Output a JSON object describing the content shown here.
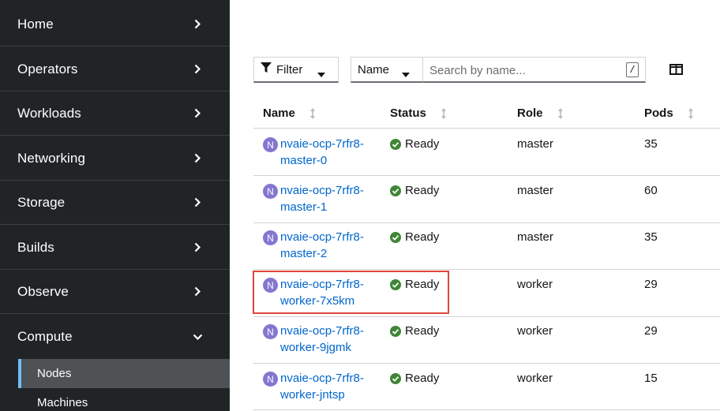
{
  "sidebar": {
    "items": [
      {
        "label": "Home",
        "expanded": false
      },
      {
        "label": "Operators",
        "expanded": false
      },
      {
        "label": "Workloads",
        "expanded": false
      },
      {
        "label": "Networking",
        "expanded": false
      },
      {
        "label": "Storage",
        "expanded": false
      },
      {
        "label": "Builds",
        "expanded": false
      },
      {
        "label": "Observe",
        "expanded": false
      },
      {
        "label": "Compute",
        "expanded": true
      }
    ],
    "compute_sub": [
      {
        "label": "Nodes",
        "active": true
      },
      {
        "label": "Machines",
        "active": false
      }
    ]
  },
  "toolbar": {
    "filter_label": "Filter",
    "name_select_label": "Name",
    "search_placeholder": "Search by name...",
    "search_value": "",
    "shortcut_key": "/"
  },
  "table": {
    "headers": {
      "name": "Name",
      "status": "Status",
      "role": "Role",
      "pods": "Pods"
    },
    "rows": [
      {
        "badge": "N",
        "name_line1": "nvaie-ocp-7rfr8-",
        "name_line2": "master-0",
        "status": "Ready",
        "role": "master",
        "pods": "35"
      },
      {
        "badge": "N",
        "name_line1": "nvaie-ocp-7rfr8-",
        "name_line2": "master-1",
        "status": "Ready",
        "role": "master",
        "pods": "60"
      },
      {
        "badge": "N",
        "name_line1": "nvaie-ocp-7rfr8-",
        "name_line2": "master-2",
        "status": "Ready",
        "role": "master",
        "pods": "35"
      },
      {
        "badge": "N",
        "name_line1": "nvaie-ocp-7rfr8-",
        "name_line2": "worker-7x5km",
        "status": "Ready",
        "role": "worker",
        "pods": "29"
      },
      {
        "badge": "N",
        "name_line1": "nvaie-ocp-7rfr8-",
        "name_line2": "worker-9jgmk",
        "status": "Ready",
        "role": "worker",
        "pods": "29"
      },
      {
        "badge": "N",
        "name_line1": "nvaie-ocp-7rfr8-",
        "name_line2": "worker-jntsp",
        "status": "Ready",
        "role": "worker",
        "pods": "15"
      }
    ]
  },
  "colors": {
    "sidebar_bg": "#212427",
    "link": "#0066cc",
    "node_badge": "#8476d1",
    "status_ok": "#3e8635",
    "highlight": "#e0453b",
    "active_indicator": "#73bcf7"
  }
}
